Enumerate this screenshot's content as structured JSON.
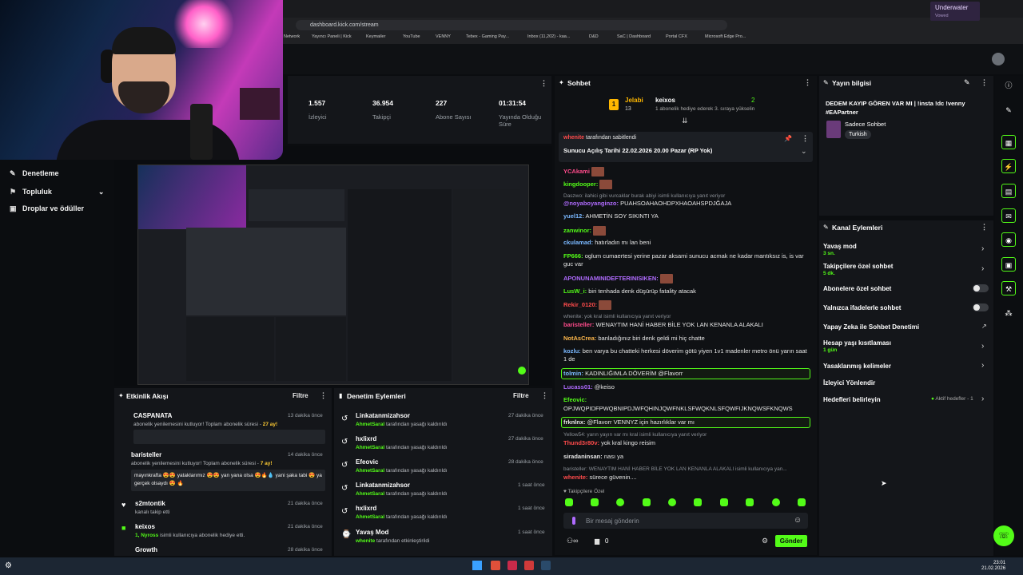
{
  "browser": {
    "url": "dashboard.kick.com/stream",
    "bookmarks": [
      "Network",
      "Yayıncı Paneli | Kick",
      "Keymailer",
      "YouTube",
      "VENNY",
      "Tebex - Gaming Pay...",
      "Inbox (11,202) - kaa...",
      "D&D",
      "SaC | Dashboard",
      "Portal CFX",
      "Microsoft Edge Pro..."
    ],
    "notification": {
      "title": "Underwater",
      "subtitle": "Vowed"
    }
  },
  "nav": {
    "items": [
      "Denetleme",
      "Topluluk",
      "Droplar ve ödüller"
    ]
  },
  "stats": [
    {
      "value": "1.557",
      "label": "İzleyici"
    },
    {
      "value": "36.954",
      "label": "Takipçi"
    },
    {
      "value": "227",
      "label": "Abone Sayısı"
    },
    {
      "value": "01:31:54",
      "label": "Yayında Olduğu Süre"
    }
  ],
  "activity": {
    "title": "Etkinlik Akışı",
    "filter": "Filtre",
    "items": [
      {
        "name": "CASPANATA",
        "text": "abonelik yenilemesini kutluyor! Toplam abonelik süresi - ",
        "highlight": "27 ay!",
        "time": "13 dakika önce"
      },
      {
        "name": "baristeller",
        "text": "abonelik yenilemesini kutluyor! Toplam abonelik süresi - ",
        "highlight": "7 ay!",
        "time": "14 dakika önce",
        "message": "mayınkrafta 😍😍 yataklarımız 😍😍 yan yana olsa 😍🔥💧 yani şaka tabi 😍 ya gerçek olsaydı 😍 🔥"
      },
      {
        "name": "s2mtontik",
        "text": "kanalı takip etti",
        "time": "21 dakika önce"
      },
      {
        "name": "keixos",
        "text": "isimli kullanıcıya abonelik hediye etti.",
        "highlight": "1, Nyross",
        "time": "21 dakika önce"
      },
      {
        "name": "Growth",
        "time": "28 dakika önce"
      }
    ]
  },
  "moderation": {
    "title": "Denetim Eylemleri",
    "filter": "Filtre",
    "items": [
      {
        "name": "Linkatanmizahsor",
        "actor": "AhmetSaral",
        "text": "tarafından yasağı kaldırıldı",
        "time": "27 dakika önce"
      },
      {
        "name": "hxlixrd",
        "actor": "AhmetSaral",
        "text": "tarafından yasağı kaldırıldı",
        "time": "27 dakika önce"
      },
      {
        "name": "Efeovic",
        "actor": "AhmetSaral",
        "text": "tarafından yasağı kaldırıldı",
        "time": "28 dakika önce"
      },
      {
        "name": "Linkatanmizahsor",
        "actor": "AhmetSaral",
        "text": "tarafından yasağı kaldırıldı",
        "time": "1 saat önce"
      },
      {
        "name": "hxlixrd",
        "actor": "AhmetSaral",
        "text": "tarafından yasağı kaldırıldı",
        "time": "1 saat önce"
      },
      {
        "name": "Yavaş Mod",
        "actor": "whenite",
        "text": "tarafından etkinleştirildi",
        "time": "1 saat önce"
      }
    ]
  },
  "chat": {
    "title": "Sohbet",
    "gift": {
      "rank": "1",
      "leader": "Jelabi",
      "count": "13",
      "second": "keixos",
      "second_count": "2",
      "note": "1 abonelik hediye ederek 3. sıraya yükselin"
    },
    "pinned": {
      "by": "tarafından sabitlendi",
      "text": "Sunucu Açılış Tarihi 22.02.2026 20.00 Pazar (RP Yok)"
    },
    "messages": [
      {
        "user": "YCAkami",
        "color": "#ff4b8b",
        "text": ""
      },
      {
        "user": "kingdooper:",
        "color": "#53fc18",
        "text": ""
      },
      {
        "reply": "Daszwo: ilahici gibi vurcaklar burak abiyi isimli kullanıcıya yanıt veriyor"
      },
      {
        "user": "@noyaboyanginzo:",
        "color": "#b06bff",
        "text": "PUAHSOAHAOHDPXHAOAHSPDJĞAJA"
      },
      {
        "user": "yuel12:",
        "color": "#7ab8ff",
        "text": "AHMETİN SOY SIKINTI YA"
      },
      {
        "user": "zanwinor:",
        "color": "#53fc18",
        "text": ""
      },
      {
        "user": "ckulamad:",
        "color": "#7ab8ff",
        "text": "hatırladın mı lan beni"
      },
      {
        "user": "FP666:",
        "color": "#53fc18",
        "text": "oglum cumaertesi yerine pazar aksami sunucu acmak ne kadar mantıksız is, is var guc var"
      },
      {
        "user": "APONUNAMINIDEFTERINISIKEN:",
        "color": "#b06bff",
        "text": ""
      },
      {
        "user": "LusW_i:",
        "color": "#53fc18",
        "text": "biri tenhada denk düşürüp fatality atacak"
      },
      {
        "user": "Rekir_0120:",
        "color": "#ff4b4b",
        "text": ""
      },
      {
        "reply": "whenite: yok kral isimli kullanıcıya yanıt veriyor"
      },
      {
        "user": "baristeller:",
        "color": "#ff4b8b",
        "text": "WENAYTIM HANİ HABER BİLE YOK LAN KENANLA ALAKALI"
      },
      {
        "user": "NotAsCrea:",
        "color": "#ffb84b",
        "text": "banladığınız biri denk geldi mi hiç chatte"
      },
      {
        "user": "kozlu:",
        "color": "#7ab8ff",
        "text": "ben varya bu chatteki herkesi döverim götü yiyen 1v1 madenler metro önü yarın saat 1 de"
      },
      {
        "user": "tolmin:",
        "color": "#7ab8ff",
        "text": "KADINLIĞIMLA DÖVERİM @Flavorr",
        "mention": true
      },
      {
        "user": "Lucass01:",
        "color": "#b06bff",
        "text": "@keiso"
      },
      {
        "user": "Efeovic:",
        "color": "#53fc18",
        "text": "OPJWQPIDFPWQBNIPDJWFQHINJQWFNKLSFWQKNLSFQWFIJKNQWSFKNQWS"
      },
      {
        "user": "frknlnx:",
        "color": "#e6e6e6",
        "text": "@Flavorr VENNYZ için hazırlıklar var mı",
        "mention": true
      },
      {
        "reply": "Yellow54: yarın yayın var mı kral isimli kullanıcıya yanıt veriyor"
      },
      {
        "user": "Thund3r80v:",
        "color": "#ff4b4b",
        "text": "yok kral kingo reisim"
      },
      {
        "user": "siradaninsan:",
        "color": "#e6e6e6",
        "text": "nası ya"
      },
      {
        "reply": "baristeller: WENAYTIM HANİ HABER BİLE YOK LAN KENANLA ALAKALI isimli kullanıcıya yan..."
      },
      {
        "user": "whenite:",
        "color": "#ff4b4b",
        "text": "sürece güvenin...."
      }
    ],
    "followers_only": "Takipçilere Özel",
    "input_placeholder": "Bir mesaj gönderin",
    "counter": "0",
    "send": "Gönder"
  },
  "stream_info": {
    "title": "Yayın bilgisi",
    "stream_title": "DEDEM KAYIP GÖREN VAR MI | !insta !dc !venny #EAPartner",
    "category": "Sadece Sohbet",
    "tag": "Turkish"
  },
  "channel_actions": {
    "title": "Kanal Eylemleri",
    "items": [
      {
        "label": "Yavaş mod",
        "sub": "3 sn.",
        "control": "chevron"
      },
      {
        "label": "Takipçilere özel sohbet",
        "sub": "5 dk.",
        "control": "chevron"
      },
      {
        "label": "Abonelere özel sohbet",
        "sub": "",
        "control": "toggle"
      },
      {
        "label": "Yalnızca ifadelerle sohbet",
        "sub": "",
        "control": "toggle"
      },
      {
        "label": "Yapay Zeka ile Sohbet Denetimi",
        "sub": "",
        "control": "external"
      },
      {
        "label": "Hesap yaşı kısıtlaması",
        "sub": "1 gün",
        "control": "chevron"
      },
      {
        "label": "Yasaklanmış kelimeler",
        "sub": "",
        "control": "chevron"
      },
      {
        "label": "İzleyici Yönlendir",
        "sub": "",
        "control": "none"
      },
      {
        "label": "Hedefleri belirleyin",
        "sub": "",
        "control": "chevron",
        "status": "Aktif hedefler - 1"
      }
    ]
  },
  "taskbar": {
    "time": "23:01",
    "date": "21.02.2026"
  },
  "colors": {
    "accent": "#53fc18",
    "panel": "#14161a",
    "background": "#0b0d10"
  }
}
